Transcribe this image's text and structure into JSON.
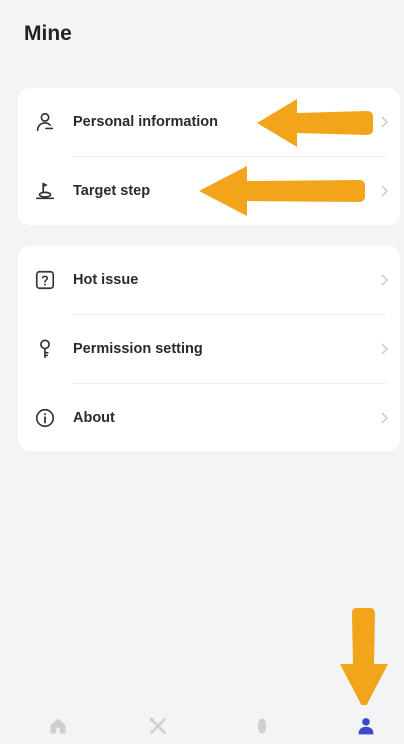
{
  "header": {
    "title": "Mine"
  },
  "menu_group_1": [
    {
      "label": "Personal information",
      "icon": "person-outline-icon"
    },
    {
      "label": "Target step",
      "icon": "joystick-icon"
    }
  ],
  "menu_group_2": [
    {
      "label": "Hot issue",
      "icon": "question-box-icon"
    },
    {
      "label": "Permission setting",
      "icon": "key-icon"
    },
    {
      "label": "About",
      "icon": "info-circle-icon"
    }
  ],
  "tabbar": {
    "items": [
      {
        "icon": "home-icon",
        "active": false
      },
      {
        "icon": "tools-icon",
        "active": false
      },
      {
        "icon": "shoe-icon",
        "active": false
      },
      {
        "icon": "person-icon",
        "active": true
      }
    ],
    "active_color": "#3d47c9",
    "inactive_color": "#cfcfcf"
  },
  "annotations": {
    "arrow_color": "#f2a51a"
  }
}
